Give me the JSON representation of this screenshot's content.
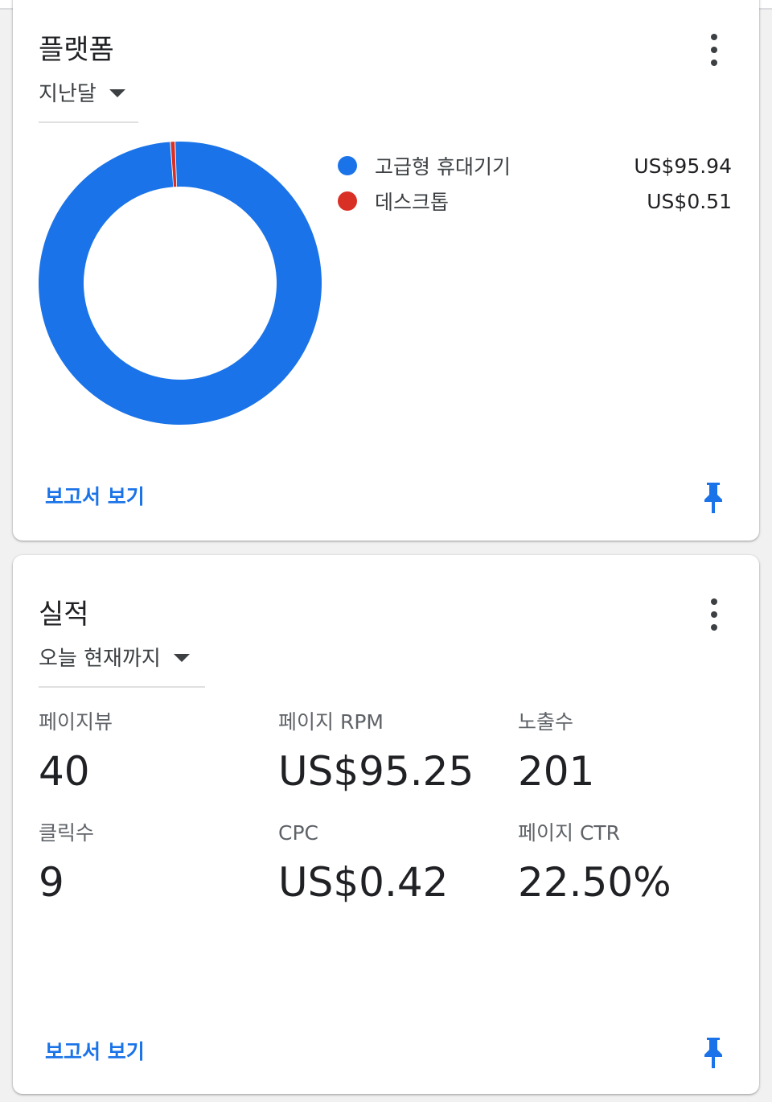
{
  "platform_card": {
    "title": "플랫폼",
    "period": "지난달",
    "legend": [
      {
        "label": "고급형 휴대기기",
        "value": "US$95.94",
        "color": "#1a73e8"
      },
      {
        "label": "데스크톱",
        "value": "US$0.51",
        "color": "#d93025"
      }
    ],
    "report_link": "보고서 보기"
  },
  "performance_card": {
    "title": "실적",
    "period": "오늘 현재까지",
    "metrics": [
      {
        "label": "페이지뷰",
        "value": "40"
      },
      {
        "label": "페이지 RPM",
        "value": "US$95.25"
      },
      {
        "label": "노출수",
        "value": "201"
      },
      {
        "label": "클릭수",
        "value": "9"
      },
      {
        "label": "CPC",
        "value": "US$0.42"
      },
      {
        "label": "페이지 CTR",
        "value": "22.50%"
      }
    ],
    "report_link": "보고서 보기"
  },
  "chart_data": {
    "type": "pie",
    "categories": [
      "고급형 휴대기기",
      "데스크톱"
    ],
    "values": [
      95.94,
      0.51
    ],
    "colors": [
      "#1a73e8",
      "#d93025"
    ],
    "donut": true
  }
}
